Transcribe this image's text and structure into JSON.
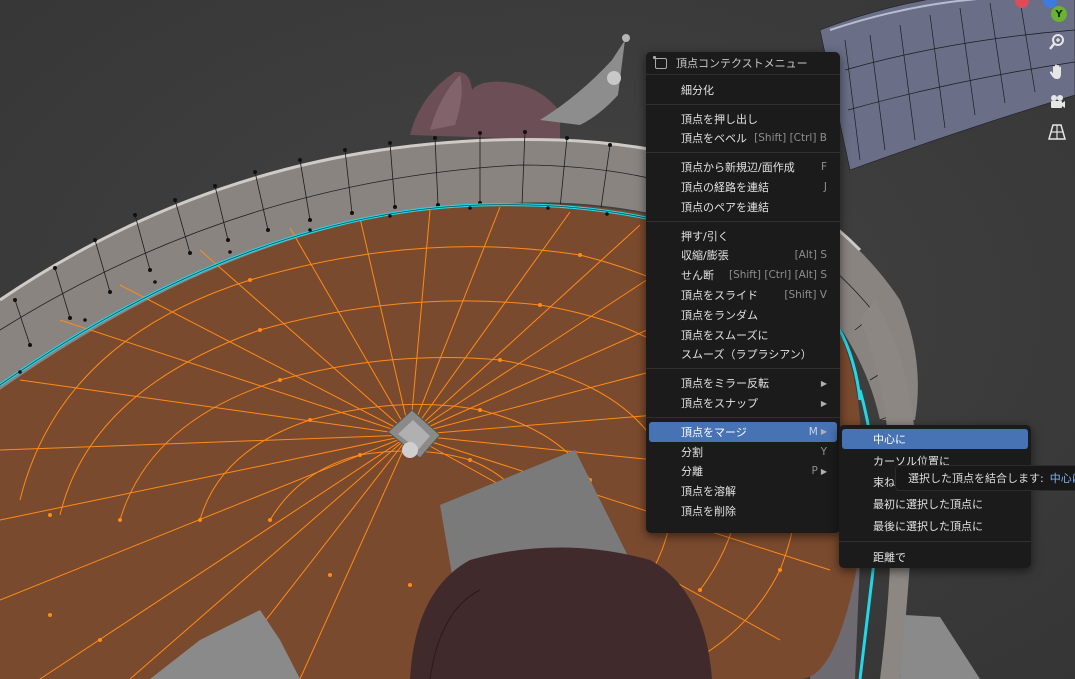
{
  "context_menu": {
    "title": "頂点コンテクストメニュー",
    "items": [
      {
        "label": "細分化"
      },
      {
        "label": "頂点を押し出し"
      },
      {
        "label": "頂点をベベル",
        "shortcut": "[Shift] [Ctrl] B"
      },
      {
        "label": "頂点から新規辺/面作成",
        "shortcut": "F"
      },
      {
        "label": "頂点の経路を連結",
        "shortcut": "J"
      },
      {
        "label": "頂点のペアを連結"
      },
      {
        "label": "押す/引く"
      },
      {
        "label": "収縮/膨張",
        "shortcut": "[Alt] S"
      },
      {
        "label": "せん断",
        "shortcut": "[Shift] [Ctrl] [Alt] S"
      },
      {
        "label": "頂点をスライド",
        "shortcut": "[Shift] V"
      },
      {
        "label": "頂点をランダム"
      },
      {
        "label": "頂点をスムーズに"
      },
      {
        "label": "スムーズ（ラプラシアン）"
      },
      {
        "label": "頂点をミラー反転",
        "submenu_arrow": "▶"
      },
      {
        "label": "頂点をスナップ",
        "submenu_arrow": "▶"
      },
      {
        "label": "頂点をマージ",
        "shortcut": "M",
        "submenu_arrow": "▶",
        "active": true
      },
      {
        "label": "分割",
        "shortcut": "Y"
      },
      {
        "label": "分離",
        "shortcut": "P",
        "submenu_arrow": "▶"
      },
      {
        "label": "頂点を溶解"
      },
      {
        "label": "頂点を削除"
      }
    ]
  },
  "merge_submenu": {
    "items": [
      {
        "label": "中心に",
        "active": true
      },
      {
        "label": "カーソル位置に"
      },
      {
        "label": "束ねる"
      },
      {
        "label": "最初に選択した頂点に"
      },
      {
        "label": "最後に選択した頂点に"
      },
      {
        "label": "距離で"
      }
    ]
  },
  "tooltip": {
    "text": "選択した頂点を結合します:",
    "highlight": "中心に"
  },
  "navigation": {
    "gizmo_axes": {
      "x_color": "#e04b57",
      "z_color": "#3d7be0",
      "y_color": "#6ab230",
      "y_label": "Y"
    },
    "buttons": [
      {
        "icon": "zoom-icon"
      },
      {
        "icon": "hand-pan-icon"
      },
      {
        "icon": "camera-icon"
      },
      {
        "icon": "grid-perspective-icon"
      }
    ]
  },
  "colors": {
    "viewport_bg": "#3d3d3d",
    "selected_face": "#7a4a2e",
    "selected_edge": "#ff8a16",
    "boundary_edge": "#25d7e6",
    "menu_bg": "#1b1b1b",
    "highlight": "#4772b3"
  }
}
